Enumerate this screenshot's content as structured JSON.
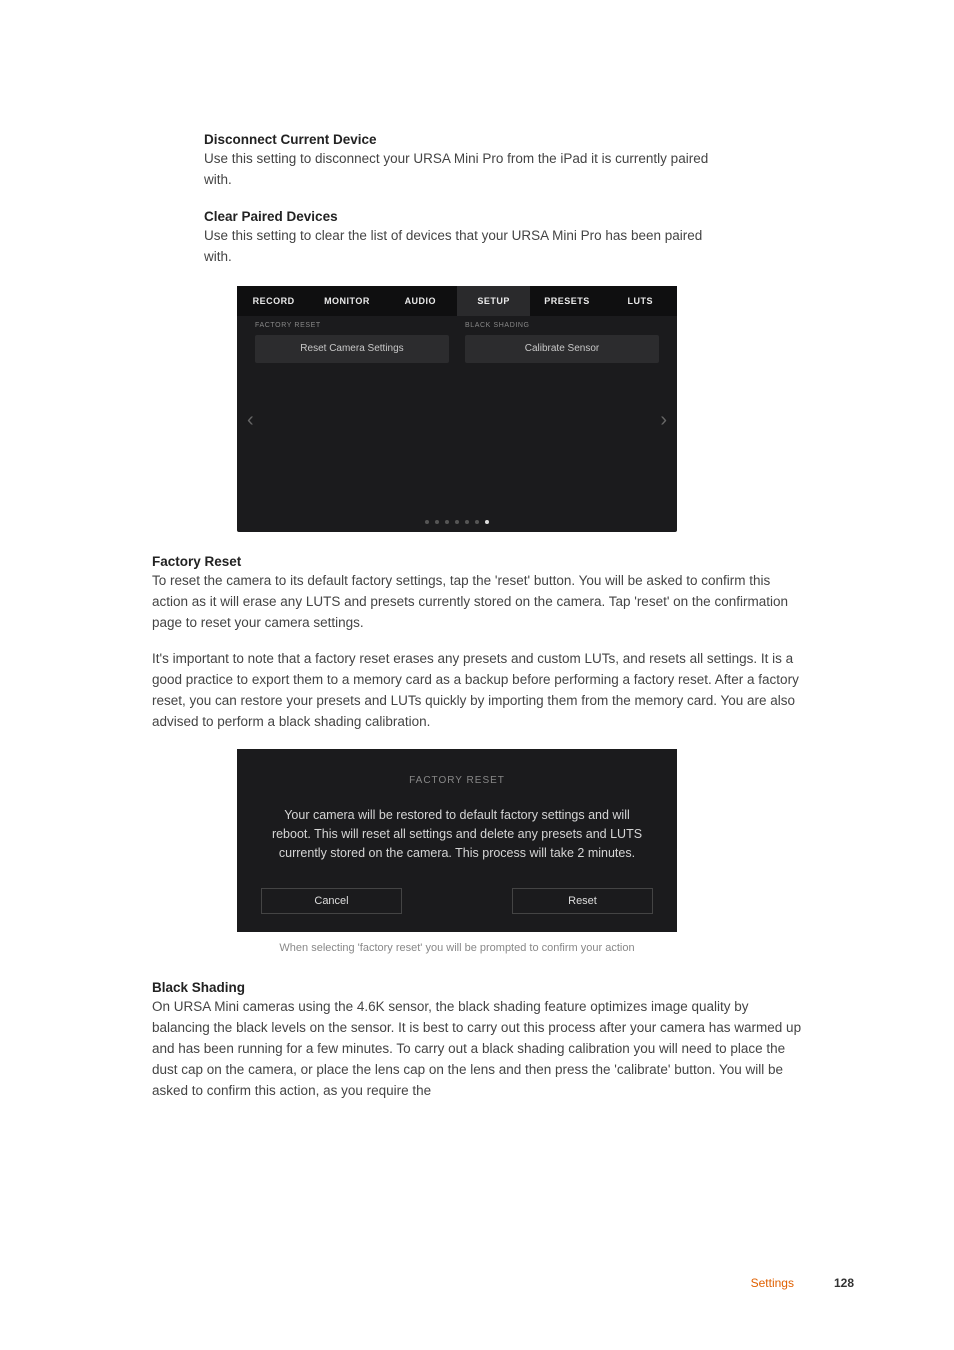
{
  "sections": {
    "disconnect": {
      "heading": "Disconnect Current Device",
      "body": "Use this setting to disconnect your URSA Mini Pro from the iPad it is currently paired with."
    },
    "clear": {
      "heading": "Clear Paired Devices",
      "body": "Use this setting to clear the list of devices that your URSA Mini Pro has been paired with."
    },
    "factory": {
      "heading": "Factory Reset",
      "p1": "To reset the camera to its default factory settings, tap the 'reset' button. You will be asked to confirm this action as it will erase any LUTS and presets currently stored on the camera. Tap 'reset' on the confirmation page to reset your camera settings.",
      "p2": "It's important to note that a factory reset erases any presets and custom LUTs, and resets all settings. It is a good practice to export them to a memory card as a backup before performing a factory reset. After a factory reset, you can restore your presets and LUTs quickly by importing them from the memory card. You are also advised to perform a black shading calibration."
    },
    "blackshading": {
      "heading": "Black Shading",
      "body": "On URSA Mini cameras using the 4.6K sensor, the black shading feature optimizes image quality by balancing the black levels on the sensor. It is best to carry out this process after your camera has warmed up and has been running for a few minutes. To carry out a black shading calibration you will need to place the dust cap on the camera, or place the lens cap on the lens and then press the 'calibrate' button. You will be asked to confirm this action, as you require the"
    }
  },
  "camera_ui": {
    "tabs": [
      "RECORD",
      "MONITOR",
      "AUDIO",
      "SETUP",
      "PRESETS",
      "LUTS"
    ],
    "active_tab_index": 3,
    "left_label": "FACTORY RESET",
    "left_button": "Reset Camera Settings",
    "right_label": "BLACK SHADING",
    "right_button": "Calibrate Sensor",
    "page_count": 7,
    "active_page_index": 6
  },
  "dialog": {
    "title": "FACTORY RESET",
    "message": "Your camera will be restored to default factory settings and will reboot. This will reset all settings and delete any presets and LUTS currently stored on the camera. This process will take 2 minutes.",
    "cancel": "Cancel",
    "reset": "Reset",
    "caption": "When selecting 'factory reset' you will be prompted to confirm your action"
  },
  "footer": {
    "section": "Settings",
    "page": "128"
  }
}
